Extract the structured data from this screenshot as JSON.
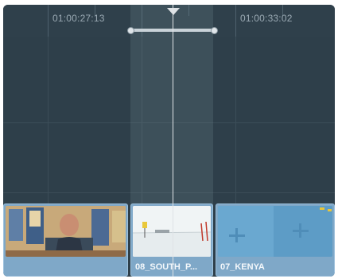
{
  "ruler": {
    "timecodes": [
      "01:00:27:13",
      "01:00:33:02"
    ]
  },
  "clips": [
    {
      "label": "",
      "thumbnail": "interview-man-with-posters"
    },
    {
      "label": "08_SOUTH_P...",
      "thumbnail": "snowy-field-antarctica"
    },
    {
      "label": "07_KENYA",
      "thumbnail": "aerial-blue-water-aircraft"
    }
  ],
  "colors": {
    "timeline_bg": "#2e3f4a",
    "clip": "#7fa8c8",
    "playhead": "#dfe3e6",
    "range": "#c9d2d8"
  }
}
